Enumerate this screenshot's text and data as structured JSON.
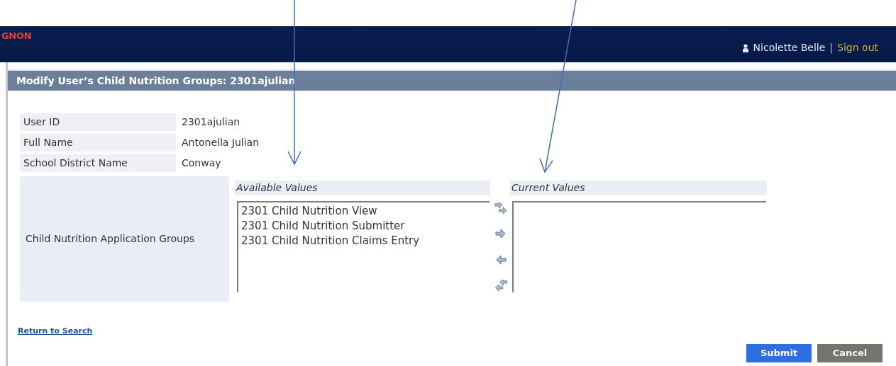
{
  "header": {
    "logo": "GNON",
    "user_name": "Nicolette Belle",
    "separator": "|",
    "sign_out": "Sign out"
  },
  "title": "Modify User’s Child Nutrition Groups: 2301ajulian",
  "fields": [
    {
      "label": "User ID",
      "value": "2301ajulian"
    },
    {
      "label": "Full Name",
      "value": "Antonella Julian"
    },
    {
      "label": "School District Name",
      "value": "Conway"
    }
  ],
  "groups": {
    "label": "Child Nutrition Application Groups",
    "available": {
      "heading": "Available Values",
      "items": [
        "2301 Child Nutrition View",
        "2301 Child Nutrition Submitter",
        "2301 Child Nutrition Claims Entry"
      ]
    },
    "current": {
      "heading": "Current Values"
    },
    "move_buttons": [
      {
        "kind": "add_all"
      },
      {
        "kind": "add"
      },
      {
        "kind": "remove"
      },
      {
        "kind": "remove_all"
      }
    ]
  },
  "return_link": "Return to Search",
  "buttons": [
    {
      "label": "Submit",
      "kind": "primary"
    },
    {
      "label": "Cancel",
      "kind": "secondary"
    }
  ]
}
